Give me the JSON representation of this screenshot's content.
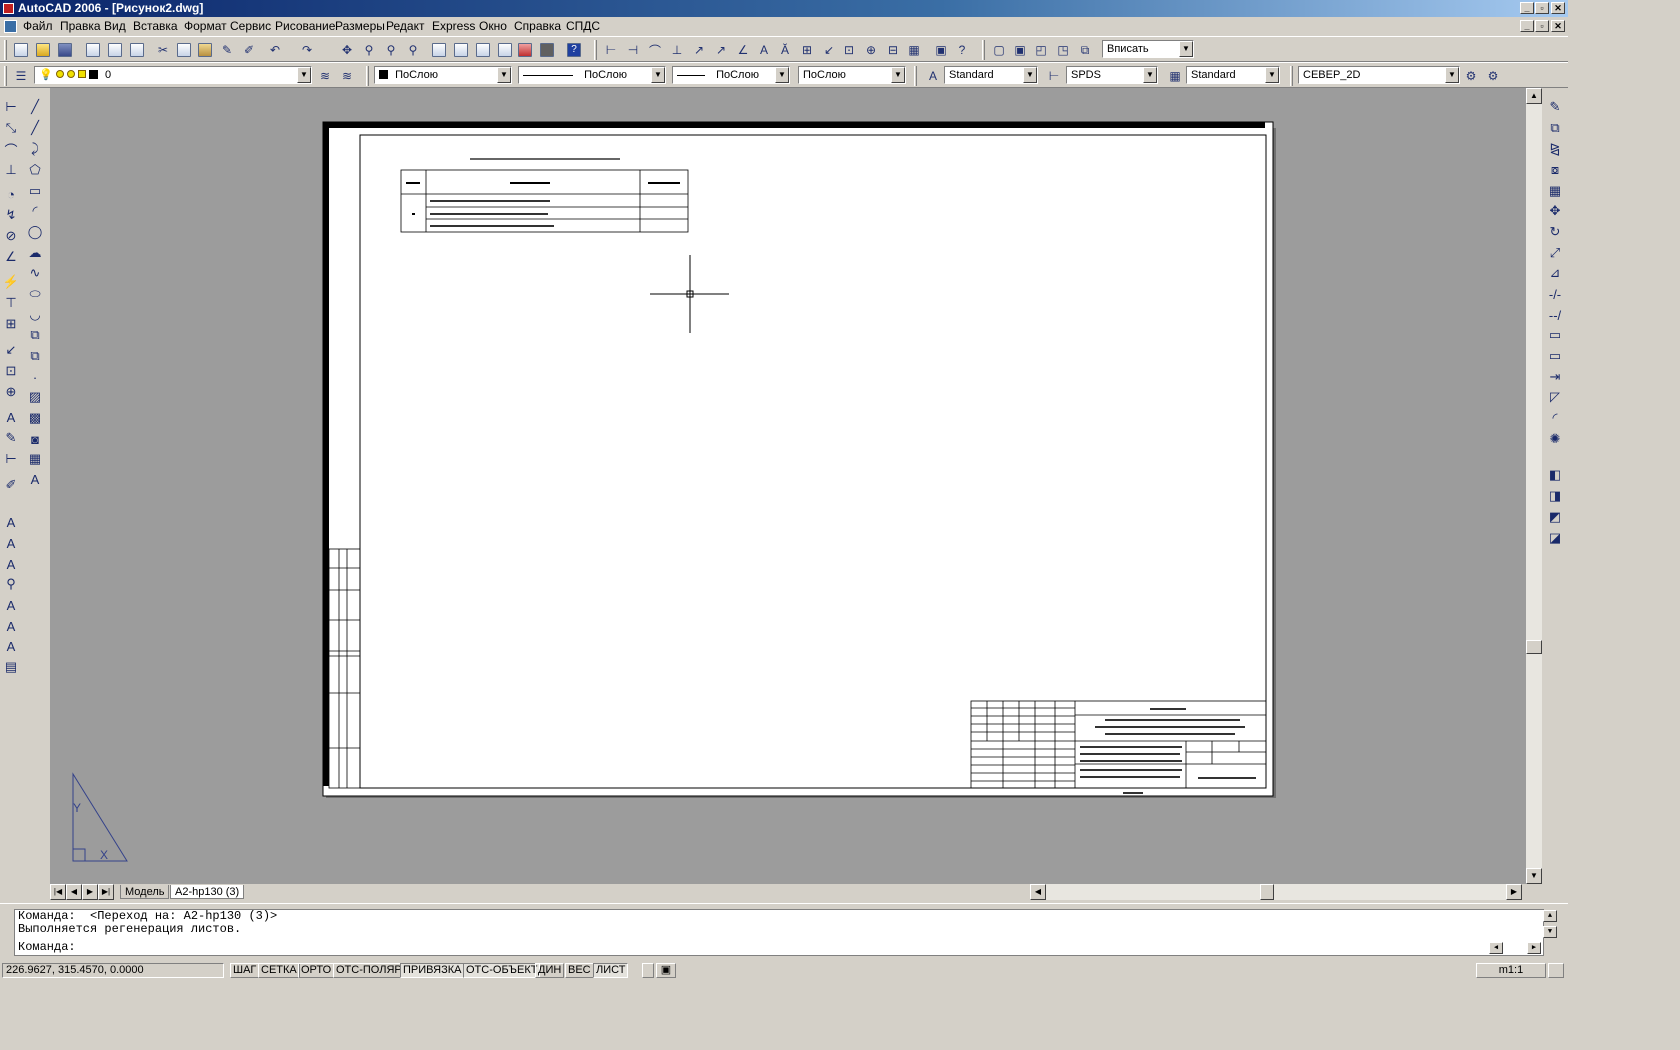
{
  "window": {
    "title": "AutoCAD 2006 - [Рисунок2.dwg]",
    "controls": [
      "_",
      "▫",
      "✕"
    ]
  },
  "menubar": {
    "items": [
      "Файл",
      "Правка",
      "Вид",
      "Вставка",
      "Формат",
      "Сервис",
      "Рисование",
      "Размеры",
      "Редакт",
      "Express",
      "Окно",
      "Справка",
      "СПДС"
    ]
  },
  "toolbar": {
    "zoom_combo": "Вписать",
    "layer_combo": "0",
    "color_combo": "ПоСлою",
    "linetype_combo": "ПоСлою",
    "lineweight_combo": "ПоСлою",
    "plotstyle_combo": "ПоСлою",
    "text_style_combo": "Standard",
    "dim_style_combo": "SPDS",
    "table_style_combo": "Standard",
    "spds_style_combo": "СЕВЕР_2D"
  },
  "layout_tabs": {
    "items": [
      "Модель",
      "A2-hp130 (3)"
    ],
    "active": "A2-hp130 (3)"
  },
  "command": {
    "lines": [
      "Команда:  <Переход на: A2-hp130 (3)>",
      "Выполняется регенерация листов."
    ],
    "prompt": "Команда:"
  },
  "statusbar": {
    "coords": "226.9627, 315.4570, 0.0000",
    "toggles": [
      "ШАГ",
      "СЕТКА",
      "ОРТО",
      "ОТС-ПОЛЯР",
      "ПРИВЯЗКА",
      "ОТС-ОБЪЕКТ",
      "ДИН",
      "ВЕС",
      "ЛИСТ"
    ],
    "scale": "m1:1"
  },
  "ucs": {
    "y_label": "Y",
    "x_label": "X"
  },
  "colors": {
    "title_gradient_start": "#0a246a",
    "canvas_background": "#9c9c9c",
    "chrome": "#d4d0c8",
    "paper": "#ffffff"
  },
  "icons": [
    "new-icon",
    "open-icon",
    "save-icon",
    "print-icon",
    "undo-icon",
    "redo-icon",
    "zoom-icon",
    "help-icon",
    "line-icon",
    "circle-icon",
    "arc-icon",
    "rectangle-icon",
    "polygon-icon",
    "text-icon",
    "move-icon",
    "rotate-icon",
    "copy-icon",
    "mirror-icon",
    "trim-icon",
    "extend-icon",
    "erase-icon",
    "crosshair-cursor-icon",
    "ucs-icon"
  ]
}
